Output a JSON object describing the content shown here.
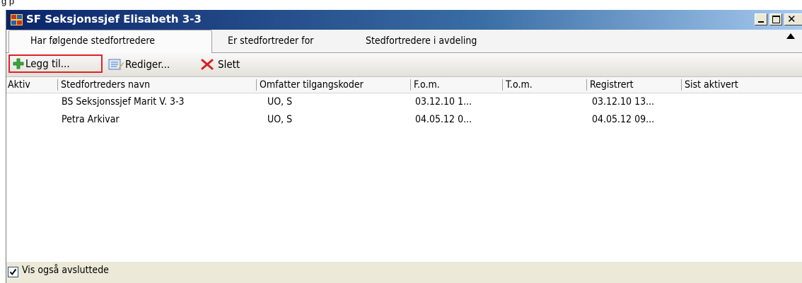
{
  "window": {
    "title": "SF Seksjonssjef Elisabeth 3-3",
    "top_caption": "g      p"
  },
  "tabs": [
    {
      "label": "Har følgende stedfortredere",
      "active": true
    },
    {
      "label": "Er stedfortreder for",
      "active": false
    },
    {
      "label": "Stedfortredere i avdeling",
      "active": false
    }
  ],
  "toolbar": {
    "add_label": "Legg til...",
    "edit_label": "Rediger...",
    "delete_label": "Slett"
  },
  "table": {
    "columns": [
      "Aktiv",
      "Stedfortreders navn",
      "Omfatter tilgangskoder",
      "F.o.m.",
      "T.o.m.",
      "Registrert",
      "Sist aktivert"
    ],
    "rows": [
      {
        "aktiv": "",
        "navn": "BS Seksjonssjef  Marit V.  3-3",
        "koder": "UO, S",
        "fom": "03.12.10 1...",
        "tom": "",
        "registrert": "03.12.10 13...",
        "sist": ""
      },
      {
        "aktiv": "",
        "navn": "Petra Arkivar",
        "koder": "UO, S",
        "fom": "04.05.12 0...",
        "tom": "",
        "registrert": "04.05.12 09...",
        "sist": ""
      }
    ]
  },
  "footer": {
    "checkbox_label": "Vis også avsluttede",
    "checked": true
  }
}
